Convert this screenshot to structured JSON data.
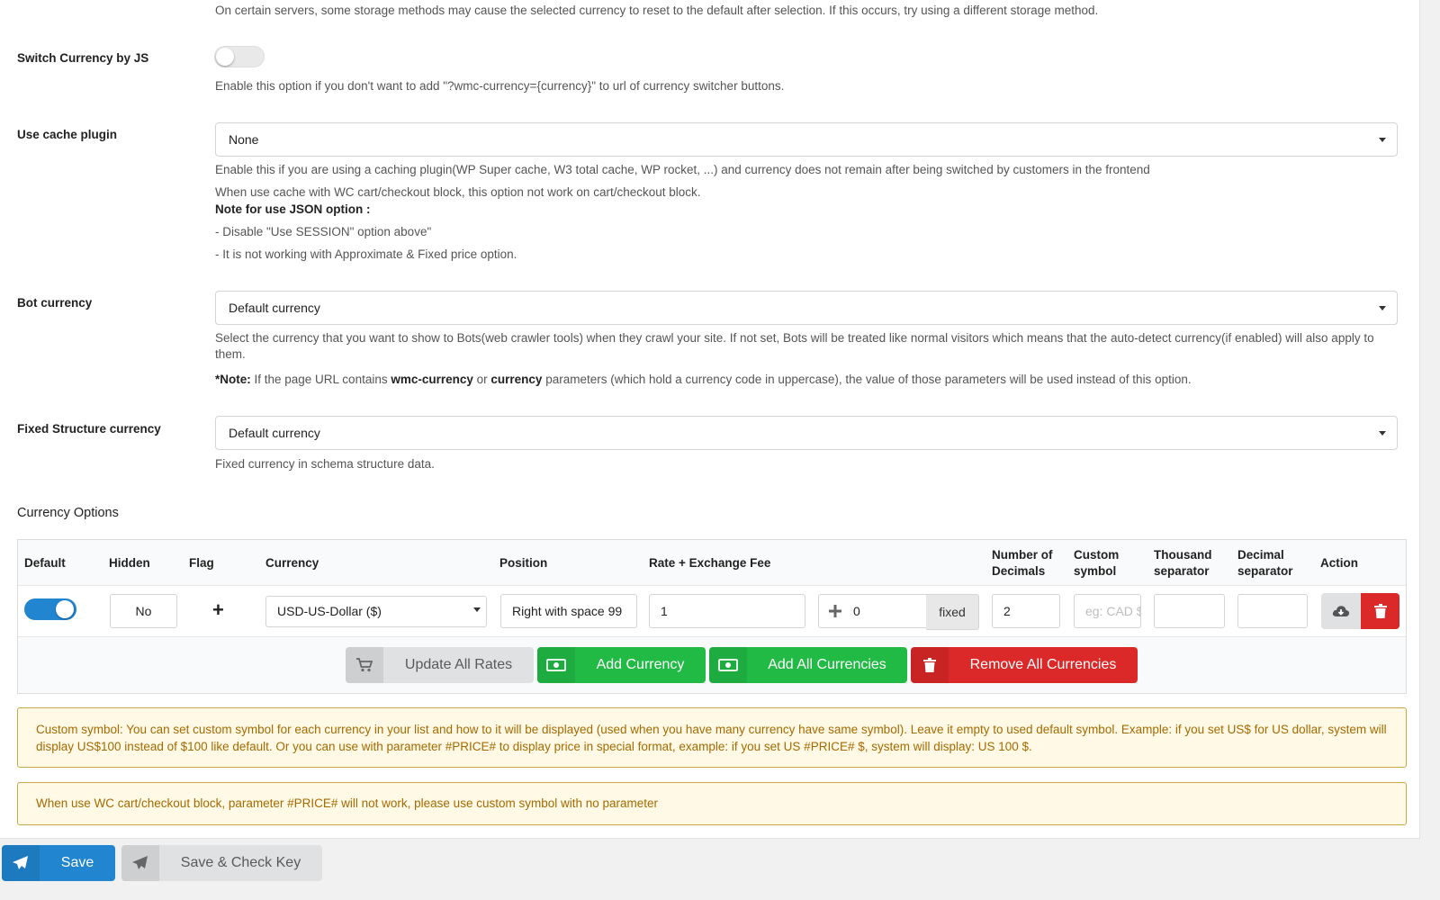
{
  "colors": {
    "primary_blue": "#2185d0",
    "green": "#21ba45",
    "red": "#db2828",
    "notice_bg": "#fff9e6",
    "notice_text": "#a56a00"
  },
  "top_desc": "On certain servers, some storage methods may cause the selected currency to reset to the default after selection. If this occurs, try using a different storage method.",
  "switch_by_js": {
    "label": "Switch Currency by JS",
    "enabled": false,
    "desc": "Enable this option if you don't want to add \"?wmc-currency={currency}\" to url of currency switcher buttons."
  },
  "cache_plugin": {
    "label": "Use cache plugin",
    "value": "None",
    "desc1": "Enable this if you are using a caching plugin(WP Super cache, W3 total cache, WP rocket, ...) and currency does not remain after being switched by customers in the frontend",
    "desc2": "When use cache with WC cart/checkout block, this option not work on cart/checkout block.",
    "note_title": "Note for use JSON option :",
    "note1": "- Disable \"Use SESSION\" option above\"",
    "note2": "- It is not working with Approximate & Fixed price option."
  },
  "bot_currency": {
    "label": "Bot currency",
    "value": "Default currency",
    "desc": "Select the currency that you want to show to Bots(web crawler tools) when they crawl your site. If not set, Bots will be treated like normal visitors which means that the auto-detect currency(if enabled) will also apply to them.",
    "note_prefix": "*Note:",
    "note_a": " If the page URL contains ",
    "note_b": "wmc-currency",
    "note_c": " or ",
    "note_d": "currency",
    "note_e": " parameters (which hold a currency code in uppercase), the value of those parameters will be used instead of this option."
  },
  "fixed_structure": {
    "label": "Fixed Structure currency",
    "value": "Default currency",
    "desc": "Fixed currency in schema structure data."
  },
  "currency_options": {
    "title": "Currency Options",
    "headers": {
      "default": "Default",
      "hidden": "Hidden",
      "flag": "Flag",
      "currency": "Currency",
      "position": "Position",
      "rate": "Rate + Exchange Fee",
      "decimals_1": "Number of",
      "decimals_2": "Decimals",
      "symbol_1": "Custom",
      "symbol_2": "symbol",
      "thousand_1": "Thousand",
      "thousand_2": "separator",
      "decimal_1": "Decimal",
      "decimal_2": "separator",
      "action": "Action"
    },
    "row": {
      "default_on": true,
      "hidden": "No",
      "flag": "+",
      "currency": "USD-US-Dollar ($)",
      "position": "Right with space 99",
      "rate": "1",
      "fee": "0",
      "fee_type": "fixed",
      "decimals": "2",
      "symbol_placeholder": "eg: CAD $",
      "thousand_sep": "",
      "decimal_sep": ""
    },
    "buttons": {
      "update_rates": "Update All Rates",
      "add_currency": "Add Currency",
      "add_all": "Add All Currencies",
      "remove_all": "Remove All Currencies"
    }
  },
  "notices": {
    "custom_symbol": "Custom symbol: You can set custom symbol for each currency in your list and how to it will be displayed (used when you have many currency have same symbol). Leave it empty to used default symbol. Example: if you set US$ for US dollar, system will display US$100 instead of $100 like default. Or you can use with parameter #PRICE# to display price in special format, example: if you set US #PRICE# $, system will display: US 100 $.",
    "price_param": "When use WC cart/checkout block, parameter #PRICE# will not work, please use custom symbol with no parameter"
  },
  "footer": {
    "save": "Save",
    "save_check": "Save & Check Key"
  }
}
